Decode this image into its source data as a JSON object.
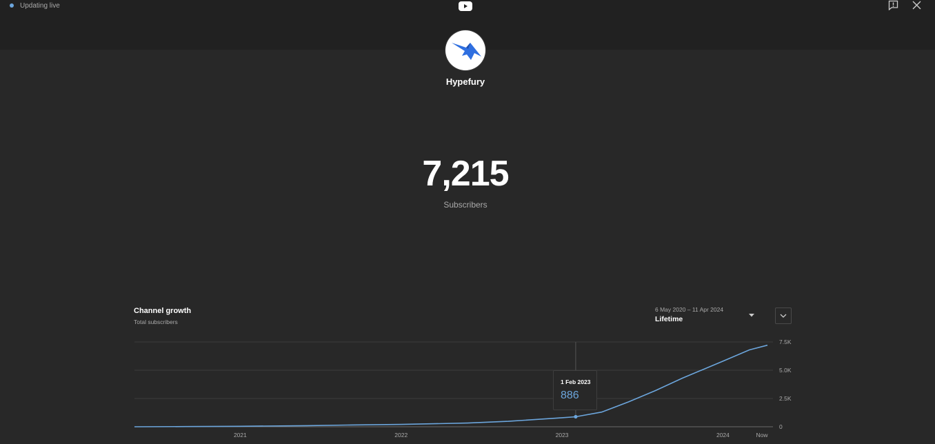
{
  "header": {
    "status_text": "Updating live",
    "status_color": "#6ca6dd",
    "logo_icon": "youtube-icon",
    "feedback_icon": "feedback-icon",
    "close_icon": "close-icon"
  },
  "channel": {
    "name": "Hypefury",
    "avatar_icon": "hypefury-bird-logo",
    "subscriber_count": "7,215",
    "subscriber_label": "Subscribers"
  },
  "growth_card": {
    "title": "Channel growth",
    "subtitle": "Total subscribers",
    "date_range": "6 May 2020 – 11 Apr 2024",
    "period": "Lifetime",
    "dropdown_icon": "caret-down-icon",
    "expand_icon": "chevron-down-icon"
  },
  "chart_data": {
    "type": "line",
    "x_tick_labels": [
      "2021",
      "2022",
      "2023",
      "2024",
      "Now"
    ],
    "y_tick_labels": [
      "0",
      "2.5K",
      "5.0K",
      "7.5K"
    ],
    "ylim": [
      0,
      7500
    ],
    "xlim": [
      "2020-05-06",
      "2024-04-11"
    ],
    "grid": true,
    "line_color": "#6ca6dd",
    "series": [
      {
        "points": [
          [
            "2020-05-06",
            0
          ],
          [
            "2020-09-01",
            20
          ],
          [
            "2021-01-01",
            45
          ],
          [
            "2021-06-01",
            100
          ],
          [
            "2021-09-01",
            150
          ],
          [
            "2022-01-01",
            210
          ],
          [
            "2022-06-01",
            330
          ],
          [
            "2022-09-01",
            480
          ],
          [
            "2023-01-01",
            800
          ],
          [
            "2023-02-01",
            886
          ],
          [
            "2023-04-01",
            1300
          ],
          [
            "2023-06-01",
            2200
          ],
          [
            "2023-08-01",
            3200
          ],
          [
            "2023-10-01",
            4300
          ],
          [
            "2024-01-01",
            5800
          ],
          [
            "2024-03-01",
            6800
          ],
          [
            "2024-04-11",
            7215
          ]
        ]
      }
    ],
    "tooltip": {
      "date": "1 Feb 2023",
      "value": "886",
      "x": "2023-02-01",
      "y": 886
    }
  }
}
